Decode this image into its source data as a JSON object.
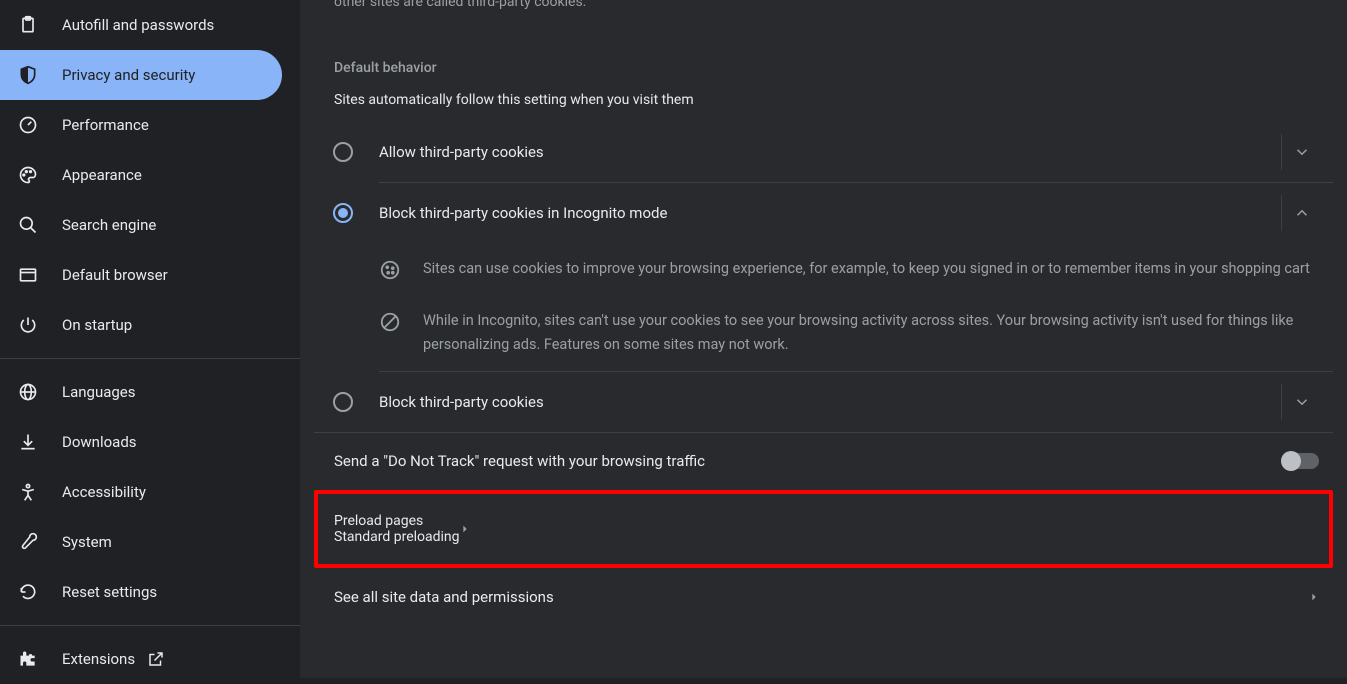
{
  "sidebar": {
    "items": [
      {
        "label": "Autofill and passwords",
        "icon": "clipboard"
      },
      {
        "label": "Privacy and security",
        "icon": "shield",
        "active": true
      },
      {
        "label": "Performance",
        "icon": "gauge"
      },
      {
        "label": "Appearance",
        "icon": "palette"
      },
      {
        "label": "Search engine",
        "icon": "search"
      },
      {
        "label": "Default browser",
        "icon": "browser"
      },
      {
        "label": "On startup",
        "icon": "power"
      }
    ],
    "items2": [
      {
        "label": "Languages",
        "icon": "globe"
      },
      {
        "label": "Downloads",
        "icon": "download"
      },
      {
        "label": "Accessibility",
        "icon": "accessibility"
      },
      {
        "label": "System",
        "icon": "wrench"
      },
      {
        "label": "Reset settings",
        "icon": "reset"
      }
    ],
    "items3": [
      {
        "label": "Extensions",
        "icon": "puzzle",
        "external": true
      }
    ]
  },
  "main": {
    "cutText": "other sites are called third-party cookies.",
    "sectionHeading": "Default behavior",
    "sectionSub": "Sites automatically follow this setting when you visit them",
    "radios": [
      {
        "label": "Allow third-party cookies",
        "selected": false,
        "expanded": false
      },
      {
        "label": "Block third-party cookies in Incognito mode",
        "selected": true,
        "expanded": true
      },
      {
        "label": "Block third-party cookies",
        "selected": false,
        "expanded": false
      }
    ],
    "details": [
      "Sites can use cookies to improve your browsing experience, for example, to keep you signed in or to remember items in your shopping cart",
      "While in Incognito, sites can't use your cookies to see your browsing activity across sites. Your browsing activity isn't used for things like personalizing ads. Features on some sites may not work."
    ],
    "dnt": "Send a \"Do Not Track\" request with your browsing traffic",
    "preload": {
      "title": "Preload pages",
      "sub": "Standard preloading"
    },
    "seeAll": "See all site data and permissions"
  }
}
